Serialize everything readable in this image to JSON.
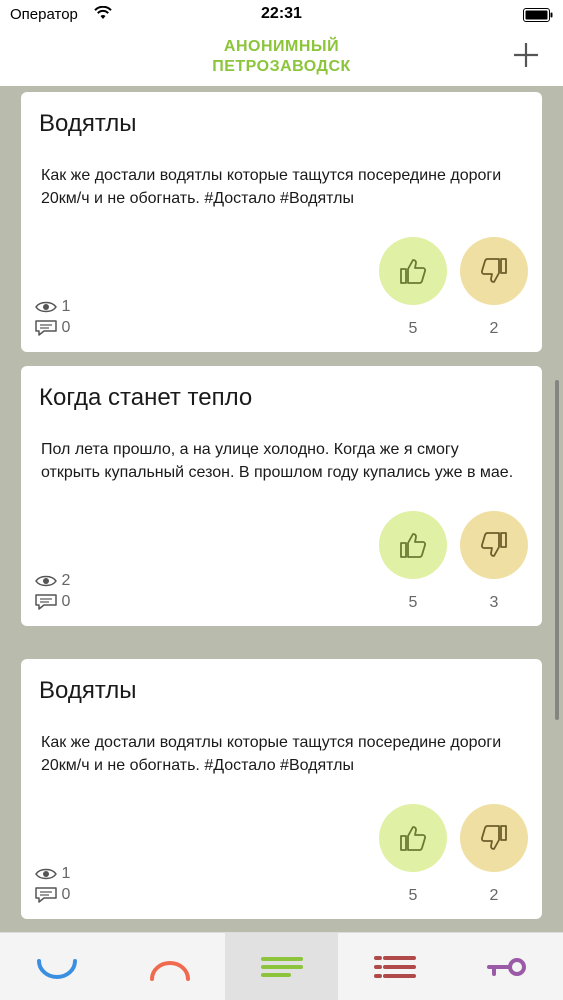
{
  "status": {
    "carrier": "Оператор",
    "time": "22:31"
  },
  "nav": {
    "title_line1": "АНОНИМНЫЙ",
    "title_line2": "ПЕТРОЗАВОДСК"
  },
  "colors": {
    "accent": "#8cc43b",
    "like_bg": "#e0f0a4",
    "dislike_bg": "#f0dfa2",
    "tab_blue": "#3a8fe0",
    "tab_red": "#ef6a4f",
    "tab_green": "#8cc43b",
    "tab_darkred": "#b04a4a",
    "tab_purple": "#9b5aa8"
  },
  "posts": [
    {
      "title": "Водятлы",
      "body": "Как же достали водятлы которые тащутся посередине дороги 20км/ч и не обогнать. #Достало #Водятлы",
      "views": "1",
      "comments": "0",
      "likes": "5",
      "dislikes": "2"
    },
    {
      "title": "Когда станет тепло",
      "body": "Пол лета прошло, а на улице холодно. Когда же я смогу открыть купальный сезон. В прошлом году купались уже в мае.",
      "views": "2",
      "comments": "0",
      "likes": "5",
      "dislikes": "3"
    },
    {
      "title": "Водятлы",
      "body": "Как же достали водятлы которые тащутся посередине дороги 20км/ч и не обогнать. #Достало #Водятлы",
      "views": "1",
      "comments": "0",
      "likes": "5",
      "dislikes": "2"
    }
  ],
  "tabs": [
    {
      "icon": "smile-arc-icon",
      "active": false
    },
    {
      "icon": "frown-arc-icon",
      "active": false
    },
    {
      "icon": "feed-lines-icon",
      "active": true
    },
    {
      "icon": "list-lines-icon",
      "active": false
    },
    {
      "icon": "key-icon",
      "active": false
    }
  ]
}
